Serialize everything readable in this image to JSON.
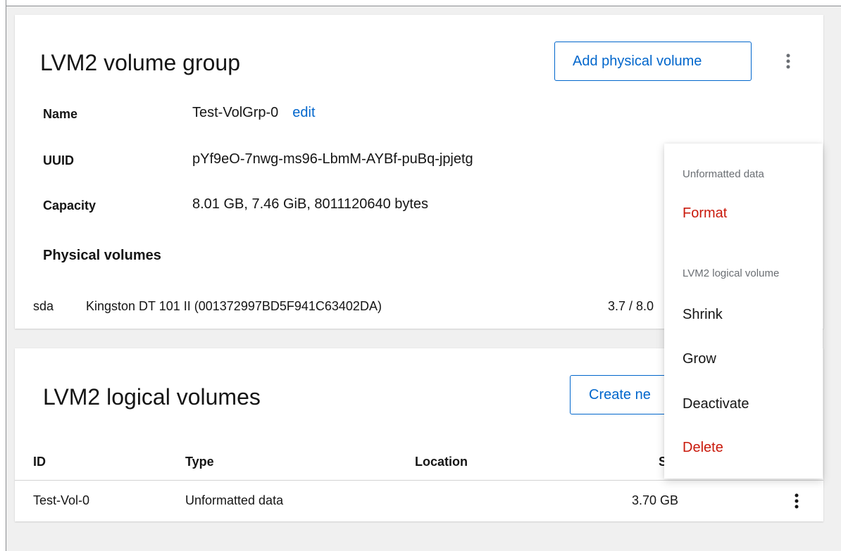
{
  "volume_group": {
    "title": "LVM2 volume group",
    "add_pv_label": "Add physical volume",
    "fields": {
      "name_label": "Name",
      "name_value": "Test-VolGrp-0",
      "edit_label": "edit",
      "uuid_label": "UUID",
      "uuid_value": "pYf9eO-7nwg-ms96-LbmM-AYBf-puBq-jpjetg",
      "capacity_label": "Capacity",
      "capacity_value": "8.01 GB, 7.46 GiB, 8011120640 bytes"
    },
    "physical_volumes_heading": "Physical volumes",
    "physical_volumes": [
      {
        "device": "sda",
        "description": "Kingston DT 101 II (001372997BD5F941C63402DA)",
        "usage": "3.7 / 8.0"
      }
    ]
  },
  "logical_volumes": {
    "title": "LVM2 logical volumes",
    "create_label": "Create ne",
    "columns": {
      "id": "ID",
      "type": "Type",
      "location": "Location",
      "size": "S"
    },
    "rows": [
      {
        "id": "Test-Vol-0",
        "type": "Unformatted data",
        "location": "",
        "size": "3.70 GB"
      }
    ]
  },
  "dropdown": {
    "group1_title": "Unformatted data",
    "format": "Format",
    "group2_title": "LVM2 logical volume",
    "shrink": "Shrink",
    "grow": "Grow",
    "deactivate": "Deactivate",
    "delete": "Delete"
  },
  "colors": {
    "link": "#0066cc",
    "danger": "#c9190b",
    "muted": "#6a6e73",
    "background": "#f0f0f0"
  }
}
